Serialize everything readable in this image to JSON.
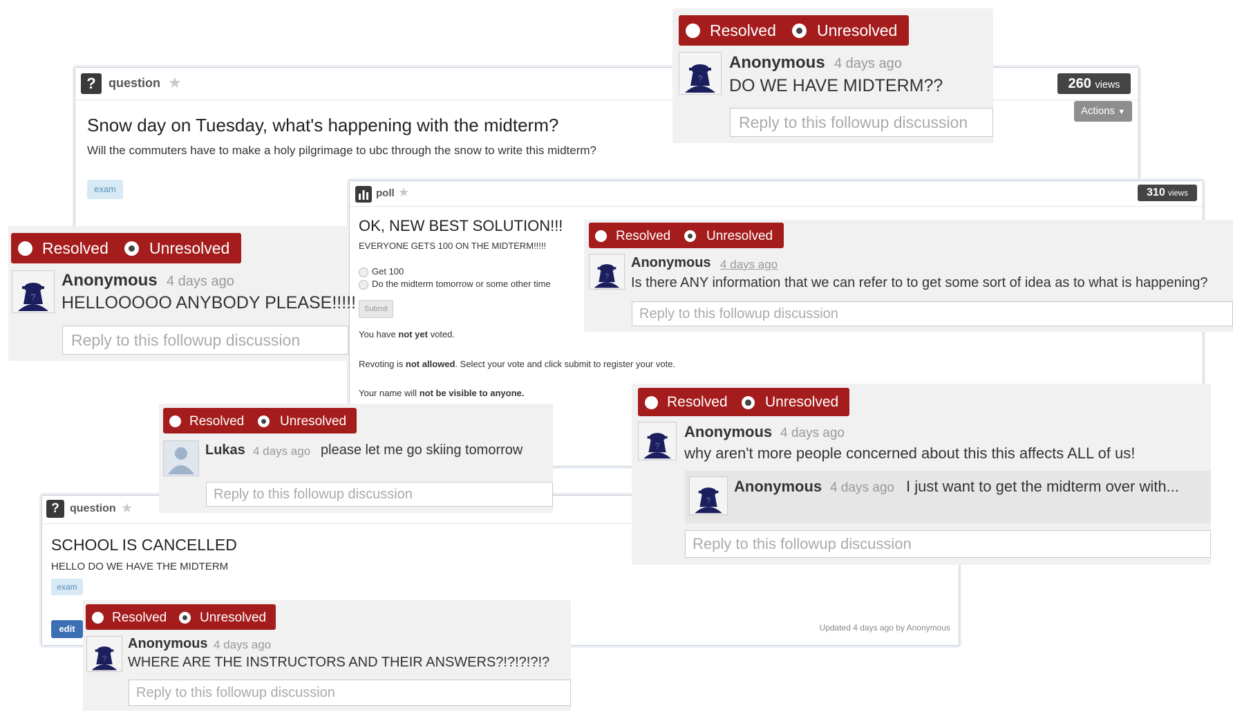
{
  "status": {
    "resolved": "Resolved",
    "unresolved": "Unresolved"
  },
  "reply_placeholder": "Reply to this followup discussion",
  "q1": {
    "type": "question",
    "views_count": "260",
    "views_label": "views",
    "actions": "Actions",
    "title": "Snow day on Tuesday, what's happening with the midterm?",
    "body": "Will the commuters have to make a holy pilgrimage to ubc through the snow to write this midterm?",
    "tag": "exam"
  },
  "poll": {
    "type": "poll",
    "views_count": "310",
    "views_label": "views",
    "title": "OK, NEW BEST SOLUTION!!!",
    "subtitle": "EVERYONE GETS 100 ON THE MIDTERM!!!!!",
    "options": [
      "Get 100",
      "Do the midterm tomorrow or some other time"
    ],
    "submit": "Submit",
    "vote_pre": "You have ",
    "vote_bold": "not yet",
    "vote_post": " voted.",
    "revote_pre": "Revoting is ",
    "revote_bold": "not allowed",
    "revote_post": ". Select your vote and click submit to register your vote.",
    "name_pre": "Your name will ",
    "name_bold": "not be visible to anyone."
  },
  "q2": {
    "type": "question",
    "title": "SCHOOL IS CANCELLED",
    "body": "HELLO DO WE HAVE THE MIDTERM",
    "tag": "exam",
    "edit": "edit",
    "updated": "Updated 4 days ago by Anonymous"
  },
  "followups": {
    "top": {
      "author": "Anonymous",
      "time": "4 days ago",
      "message": "DO WE HAVE MIDTERM??"
    },
    "left": {
      "author": "Anonymous",
      "time": "4 days ago",
      "message": "HELLOOOOO ANYBODY PLEASE!!!!!"
    },
    "info": {
      "author": "Anonymous",
      "time": "4 days ago",
      "message": "Is there ANY information that we can refer to to get some sort of idea as to what is happening?"
    },
    "lukas": {
      "author": "Lukas",
      "time": "4 days ago",
      "message": "please let me go skiing tomorrow"
    },
    "concerned": {
      "author": "Anonymous",
      "time": "4 days ago",
      "message": "why aren't more people concerned about this this affects ALL of us!"
    },
    "nested": {
      "author": "Anonymous",
      "time": "4 days ago",
      "message": "I just want to get the midterm over with..."
    },
    "instructors": {
      "author": "Anonymous",
      "time": "4 days ago",
      "message": "WHERE ARE THE INSTRUCTORS AND THEIR ANSWERS?!?!?!?!?"
    }
  },
  "colors": {
    "resolve_bar": "#a41c1c",
    "tag_bg": "#d6e9f5",
    "views_bg": "#444444",
    "edit_bg": "#3d6fb5"
  },
  "icons": [
    "question-icon",
    "poll-icon",
    "star-icon",
    "anonymous-avatar-icon",
    "user-avatar-icon",
    "caret-down-icon"
  ]
}
